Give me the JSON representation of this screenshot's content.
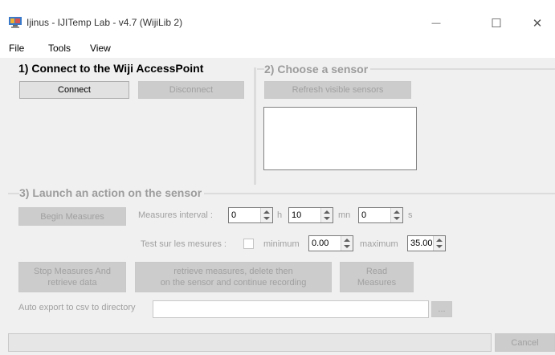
{
  "window": {
    "title": "Ijinus - IJITemp Lab - v4.7  (WijiLib 2)",
    "controls": {
      "minimize": "—",
      "maximize": "☐",
      "close": "✕"
    }
  },
  "menu": {
    "items": [
      "File",
      "Tools",
      "View"
    ]
  },
  "connect_group": {
    "title": "1) Connect to the Wiji AccessPoint",
    "connect_label": "Connect",
    "disconnect_label": "Disconnect"
  },
  "sensor_group": {
    "title": "2) Choose a sensor",
    "refresh_label": "Refresh visible sensors"
  },
  "action_group": {
    "title": "3) Launch an action on the sensor",
    "begin_label": "Begin Measures",
    "interval_label": "Measures interval :",
    "interval_hours": "0",
    "hours_unit": "h",
    "interval_minutes": "10",
    "minutes_unit": "mn",
    "interval_seconds": "0",
    "seconds_unit": "s",
    "test_label": "Test sur les mesures :",
    "minimum_label": "minimum",
    "minimum_value": "0.00",
    "maximum_label": "maximum",
    "maximum_value": "35.00",
    "stop_line1": "Stop Measures And",
    "stop_line2": "retrieve data",
    "retrieve_line1": "retrieve measures, delete then",
    "retrieve_line2": "on the sensor and continue recording",
    "read_line1": "Read",
    "read_line2": "Measures",
    "export_label": "Auto export to csv to directory",
    "export_value": "",
    "browse_label": "..."
  },
  "status": {
    "cancel_label": "Cancel"
  },
  "colors": {
    "disabled_text": "#a0a0a0",
    "disabled_button": "#cccccc",
    "window_bg": "#f0f0f0"
  }
}
